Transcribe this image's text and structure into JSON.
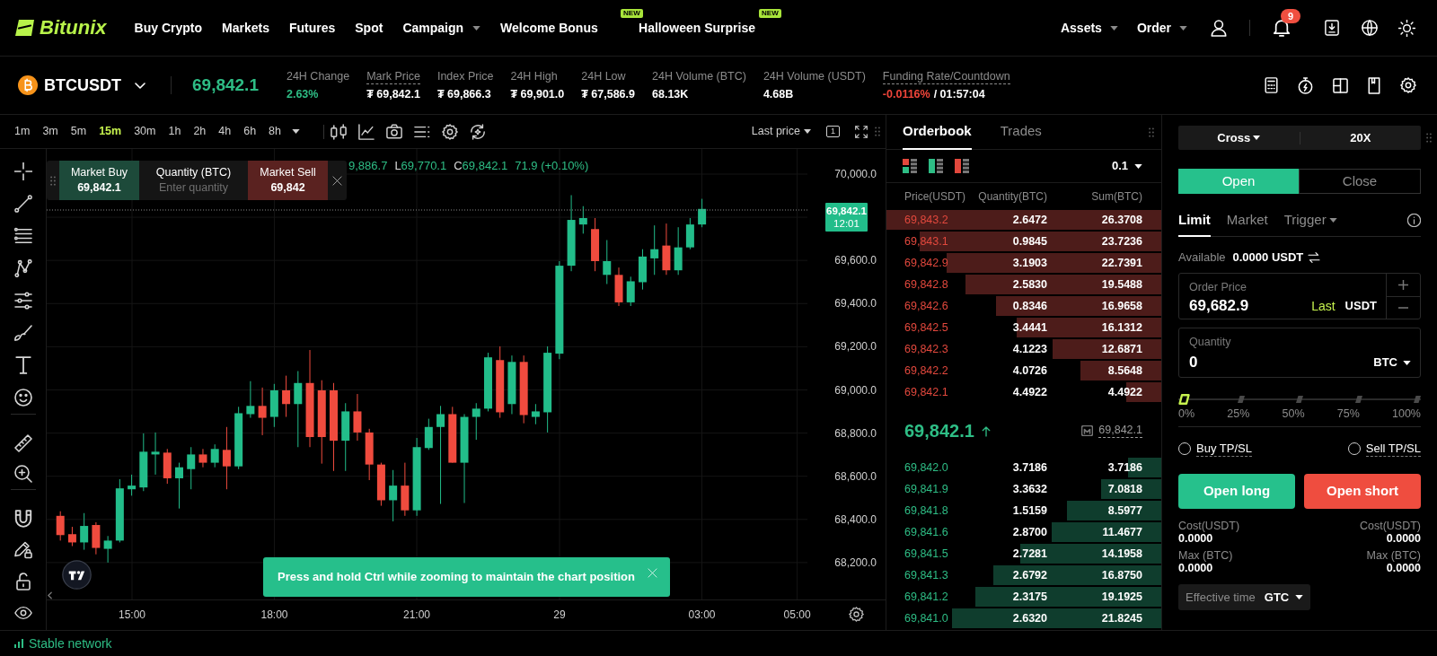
{
  "nav": {
    "logo": "Bitunix",
    "links": [
      {
        "label": "Buy Crypto",
        "dropdown": false
      },
      {
        "label": "Markets",
        "dropdown": false
      },
      {
        "label": "Futures",
        "dropdown": false
      },
      {
        "label": "Spot",
        "dropdown": false
      },
      {
        "label": "Campaign",
        "dropdown": true
      },
      {
        "label": "Welcome Bonus",
        "dropdown": false,
        "badge": "NEW"
      },
      {
        "label": "Halloween Surprise",
        "dropdown": false,
        "badge": "NEW"
      }
    ],
    "menus": [
      {
        "label": "Assets",
        "dropdown": true
      },
      {
        "label": "Order",
        "dropdown": true
      }
    ],
    "notification_count": "9"
  },
  "ticker": {
    "symbol": "BTCUSDT",
    "last_price": "69,842.1",
    "stats": [
      {
        "label": "24H Change",
        "value": "2.63%",
        "color": "#2ebd85",
        "dashed": false
      },
      {
        "label": "Mark Price",
        "value": "₮ 69,842.1",
        "color": "#ffffff",
        "dashed": true
      },
      {
        "label": "Index Price",
        "value": "₮ 69,866.3",
        "color": "#ffffff",
        "dashed": false
      },
      {
        "label": "24H High",
        "value": "₮ 69,901.0",
        "color": "#ffffff",
        "dashed": false
      },
      {
        "label": "24H Low",
        "value": "₮ 67,586.9",
        "color": "#ffffff",
        "dashed": false
      },
      {
        "label": "24H Volume (BTC)",
        "value": "68.13K",
        "color": "#ffffff",
        "dashed": false
      },
      {
        "label": "24H Volume (USDT)",
        "value": "4.68B",
        "color": "#ffffff",
        "dashed": false
      },
      {
        "label": "Funding Rate/Countdown",
        "value": "-0.0116%",
        "color": "#f0453a",
        "dashed": true,
        "countdown": "/ 01:57:04"
      }
    ]
  },
  "chart": {
    "intervals": [
      {
        "label": "1m",
        "selected": false
      },
      {
        "label": "3m",
        "selected": false
      },
      {
        "label": "5m",
        "selected": false
      },
      {
        "label": "15m",
        "selected": true
      },
      {
        "label": "30m",
        "selected": false
      },
      {
        "label": "1h",
        "selected": false
      },
      {
        "label": "2h",
        "selected": false
      },
      {
        "label": "4h",
        "selected": false
      },
      {
        "label": "6h",
        "selected": false
      },
      {
        "label": "8h",
        "selected": false
      }
    ],
    "price_source": "Last price",
    "layout_count": "1",
    "legend": [
      {
        "value": "9,886.7"
      },
      {
        "label": "L",
        "value": "69,770.1"
      },
      {
        "label": "C",
        "value": "69,842.1"
      },
      {
        "value": "71.9 (+0.10%)"
      }
    ],
    "quick_trade": {
      "buy_label": "Market Buy",
      "buy_price": "69,842.1",
      "quantity_label": "Quantity (BTC)",
      "quantity_placeholder": "Enter quantity",
      "sell_label": "Market Sell",
      "sell_price": "69,842"
    },
    "price_axis": [
      "70,000.0",
      "69,600.0",
      "69,400.0",
      "69,200.0",
      "69,000.0",
      "68,800.0",
      "68,600.0",
      "68,400.0",
      "68,200.0"
    ],
    "price_badge": {
      "price": "69,842.1",
      "countdown": "12:01"
    },
    "time_axis": [
      "15:00",
      "18:00",
      "21:00",
      "29",
      "03:00",
      "05:00"
    ],
    "toast": "Press and hold Ctrl while zooming to maintain the chart position"
  },
  "orderbook": {
    "tabs": [
      {
        "label": "Orderbook",
        "selected": true
      },
      {
        "label": "Trades",
        "selected": false
      }
    ],
    "precision": "0.1",
    "columns": [
      "Price(USDT)",
      "Quantity(BTC)",
      "Sum(BTC)"
    ],
    "asks": [
      {
        "price": "69,843.2",
        "quantity": "2.6472",
        "sum": "26.3708",
        "level": 1.0
      },
      {
        "price": "69,843.1",
        "quantity": "0.9845",
        "sum": "23.7236",
        "level": 0.878
      },
      {
        "price": "69,842.9",
        "quantity": "3.1903",
        "sum": "22.7391",
        "level": 0.78
      },
      {
        "price": "69,842.8",
        "quantity": "2.5830",
        "sum": "19.5488",
        "level": 0.713
      },
      {
        "price": "69,842.6",
        "quantity": "0.8346",
        "sum": "16.9658",
        "level": 0.6
      },
      {
        "price": "69,842.5",
        "quantity": "3.4441",
        "sum": "16.1312",
        "level": 0.525
      },
      {
        "price": "69,842.3",
        "quantity": "4.1223",
        "sum": "12.6871",
        "level": 0.396
      },
      {
        "price": "69,842.2",
        "quantity": "4.0726",
        "sum": "8.5648",
        "level": 0.293
      },
      {
        "price": "69,842.1",
        "quantity": "4.4922",
        "sum": "4.4922",
        "level": 0.128
      }
    ],
    "last_price": "69,842.1",
    "mark_price": "69,842.1",
    "bids": [
      {
        "price": "69,842.0",
        "quantity": "3.7186",
        "sum": "3.7186",
        "level": 0.122
      },
      {
        "price": "69,841.9",
        "quantity": "3.3632",
        "sum": "7.0818",
        "level": 0.22
      },
      {
        "price": "69,841.8",
        "quantity": "1.5159",
        "sum": "8.5977",
        "level": 0.342
      },
      {
        "price": "69,841.6",
        "quantity": "2.8700",
        "sum": "11.4677",
        "level": 0.4
      },
      {
        "price": "69,841.5",
        "quantity": "2.7281",
        "sum": "14.1958",
        "level": 0.512
      },
      {
        "price": "69,841.3",
        "quantity": "2.6792",
        "sum": "16.8750",
        "level": 0.61
      },
      {
        "price": "69,841.2",
        "quantity": "2.3175",
        "sum": "19.1925",
        "level": 0.678
      },
      {
        "price": "69,841.0",
        "quantity": "2.6320",
        "sum": "21.8245",
        "level": 0.76
      }
    ]
  },
  "order_form": {
    "margin_mode": "Cross",
    "leverage": "20X",
    "sides": [
      {
        "label": "Open",
        "selected": true
      },
      {
        "label": "Close",
        "selected": false
      }
    ],
    "order_types": [
      {
        "label": "Limit",
        "selected": true,
        "dropdown": false
      },
      {
        "label": "Market",
        "selected": false,
        "dropdown": false
      },
      {
        "label": "Trigger",
        "selected": false,
        "dropdown": true
      }
    ],
    "available_label": "Available",
    "available_value": "0.0000 USDT",
    "price_field": {
      "label": "Order Price",
      "value": "69,682.9",
      "tag": "Last",
      "unit": "USDT"
    },
    "quantity_field": {
      "label": "Quantity",
      "value": "0",
      "unit": "BTC"
    },
    "slider": {
      "level": 0,
      "marks": [
        "0%",
        "25%",
        "50%",
        "75%",
        "100%"
      ]
    },
    "tpsl": [
      {
        "label": "Buy TP/SL",
        "checked": false
      },
      {
        "label": "Sell TP/SL",
        "checked": false
      }
    ],
    "buttons": [
      {
        "label": "Open long",
        "kind": "long"
      },
      {
        "label": "Open short",
        "kind": "short"
      }
    ],
    "summary": [
      {
        "items": [
          {
            "label": "Cost(USDT)",
            "value": "0.0000"
          },
          {
            "label": "Max (BTC)",
            "value": "0.0000"
          }
        ]
      },
      {
        "items": [
          {
            "label": "Cost(USDT)",
            "value": "0.0000"
          },
          {
            "label": "Max (BTC)",
            "value": "0.0000"
          }
        ]
      }
    ],
    "effective_time": {
      "label": "Effective time",
      "value": "GTC"
    }
  },
  "status_bar": {
    "network": "Stable network"
  }
}
